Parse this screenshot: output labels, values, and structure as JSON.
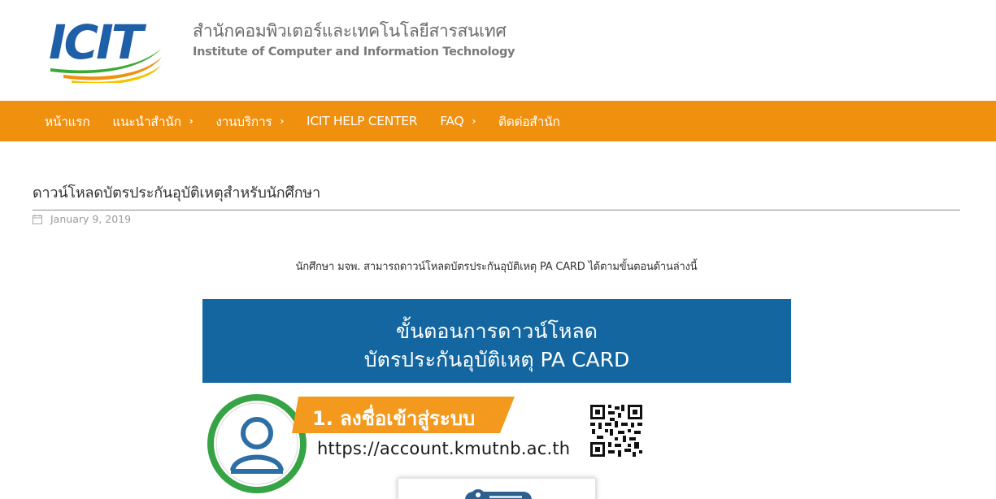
{
  "header": {
    "logo_text": "ICIT",
    "site_title": "สำนักคอมพิวเตอร์และเทคโนโลยีสารสนเทศ",
    "site_subtitle": "Institute of Computer and Information Technology"
  },
  "nav": {
    "items": [
      {
        "label": "หน้าแรก",
        "has_submenu": false
      },
      {
        "label": "แนะนำสำนัก",
        "has_submenu": true
      },
      {
        "label": "งานบริการ",
        "has_submenu": true
      },
      {
        "label": "ICIT HELP CENTER",
        "has_submenu": false
      },
      {
        "label": "FAQ",
        "has_submenu": true
      },
      {
        "label": "ติดต่อสำนัก",
        "has_submenu": false
      }
    ],
    "chevron": "›"
  },
  "post": {
    "title": "ดาวน์โหลดบัตรประกันอุบัติเหตุสำหรับนักศึกษา",
    "date": "January 9, 2019",
    "intro": "นักศึกษา มจพ. สามารถดาวน์โหลดบัตรประกันอุบัติเหตุ PA CARD ได้ตามขั้นตอนด้านล่างนี้"
  },
  "infographic": {
    "heading_line1": "ขั้นตอนการดาวน์โหลด",
    "heading_line2": "บัตรประกันอุบัติเหตุ PA CARD",
    "step1_label": "1. ลงชื่อเข้าสู่ระบบ",
    "step1_url": "https://account.kmutnb.ac.th"
  },
  "colors": {
    "nav_bg": "#f0900f",
    "banner_bg": "#1366a0",
    "logo_blue": "#1f5fa8",
    "logo_green": "#3aa935",
    "logo_orange": "#f0900f",
    "badge_green": "#36a345",
    "badge_blue": "#2d6fa5"
  },
  "icons": {
    "calendar": "calendar-icon",
    "user": "user-icon",
    "qr": "qr-code-icon"
  }
}
